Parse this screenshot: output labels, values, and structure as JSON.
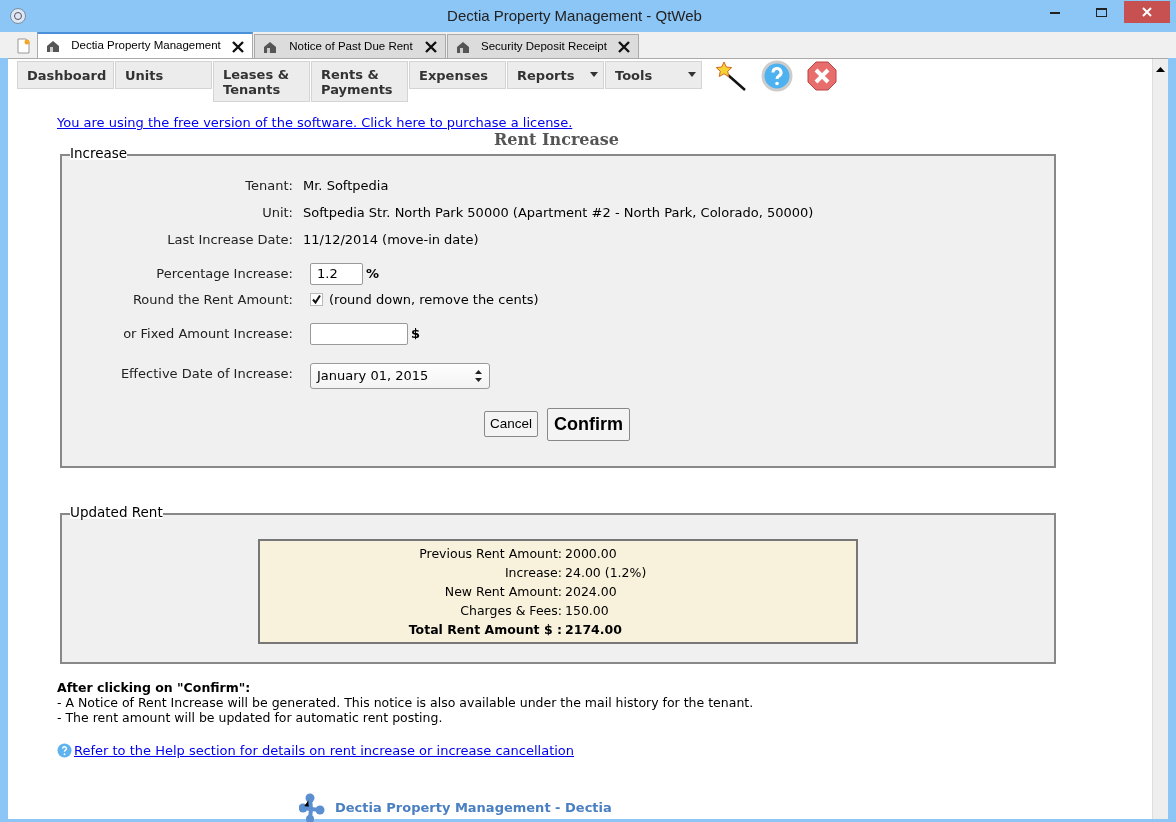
{
  "window": {
    "title": "Dectia Property Management - QtWeb"
  },
  "tabs": [
    {
      "label": "Dectia Property Management",
      "selected": true
    },
    {
      "label": "Notice of Past Due Rent",
      "selected": false
    },
    {
      "label": "Security Deposit Receipt",
      "selected": false
    }
  ],
  "menu": [
    {
      "label": "Dashboard",
      "dropdown": false
    },
    {
      "label": "Units",
      "dropdown": false
    },
    {
      "label": "Leases & Tenants",
      "dropdown": false
    },
    {
      "label": "Rents & Payments",
      "dropdown": false
    },
    {
      "label": "Expenses",
      "dropdown": false
    },
    {
      "label": "Reports",
      "dropdown": true
    },
    {
      "label": "Tools",
      "dropdown": true
    }
  ],
  "license_link": "You are using the free version of the software. Click here to purchase a license.",
  "heading": "Rent Increase",
  "increase": {
    "legend": "Increase",
    "fields": [
      {
        "kind": "text",
        "label": "Tenant:",
        "value": "Mr. Softpedia"
      },
      {
        "kind": "text",
        "label": "Unit:",
        "value": "Softpedia Str. North Park 50000 (Apartment #2 - North Park, Colorado, 50000)"
      },
      {
        "kind": "text",
        "label": "Last Increase Date:",
        "value": "11/12/2014 (move-in date)"
      },
      {
        "kind": "input",
        "label": "Percentage Increase:",
        "value": "1.2",
        "suffix": "%"
      },
      {
        "kind": "checkbox",
        "label": "Round the Rent Amount:",
        "checked": true,
        "note": "(round down, remove the cents)"
      },
      {
        "kind": "input",
        "label": "or Fixed Amount Increase:",
        "suffix": "$"
      },
      {
        "kind": "select",
        "label": "Effective Date of Increase:",
        "value": "January 01, 2015"
      }
    ],
    "cancel": "Cancel",
    "confirm": "Confirm"
  },
  "updated_rent": {
    "legend": "Updated Rent",
    "rows": [
      {
        "label": "Previous Rent Amount:",
        "value": "2000.00",
        "bold": false
      },
      {
        "label": "Increase:",
        "value": "24.00 (1.2%)",
        "bold": false
      },
      {
        "label": "New Rent Amount:",
        "value": "2024.00",
        "bold": false
      },
      {
        "label": "Charges & Fees:",
        "value": "150.00",
        "bold": false
      },
      {
        "label": "Total Rent Amount $ :",
        "value": "2174.00",
        "bold": true
      }
    ]
  },
  "notes": {
    "title": "After clicking on \"Confirm\":",
    "lines": [
      "- A Notice of Rent Increase will be generated. This notice is also available under the mail history for the tenant.",
      "- The rent amount will be updated for automatic rent posting."
    ]
  },
  "help_link": "Refer to the Help section for details on rent increase or increase cancellation",
  "footer": "Dectia Property Management - Dectia"
}
